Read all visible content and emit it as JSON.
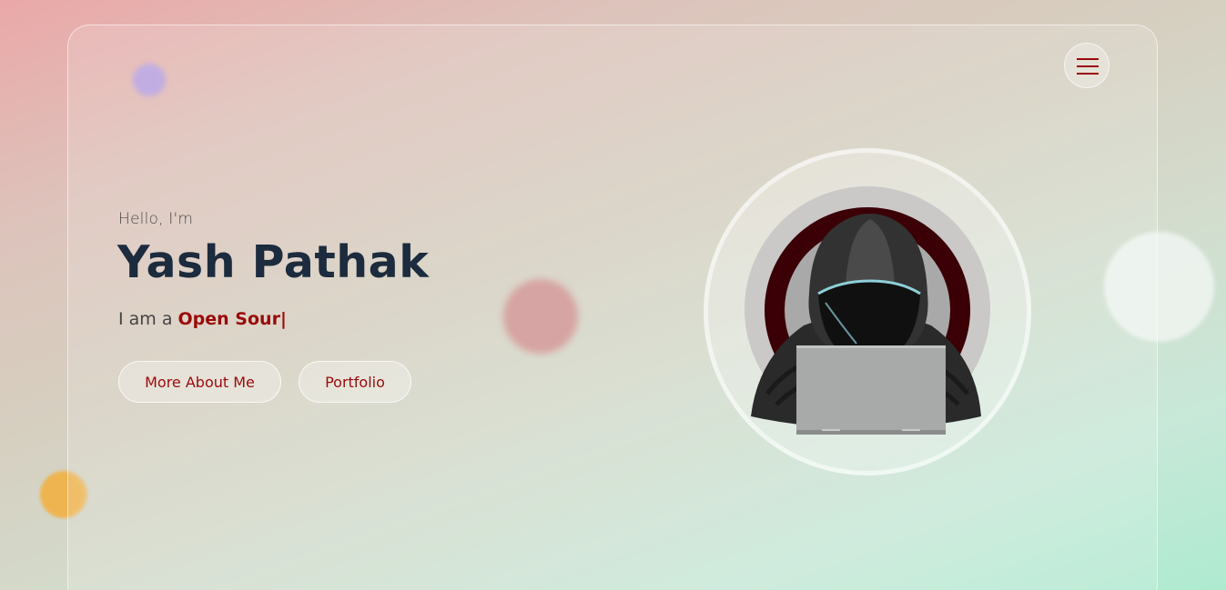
{
  "hero": {
    "greeting": "Hello, I'm",
    "name": "Yash Pathak",
    "role_prefix": "I am a ",
    "role_typed": "Open Sour",
    "caret": "|"
  },
  "buttons": {
    "about_label": "More About Me",
    "portfolio_label": "Portfolio"
  },
  "nav": {
    "menu_icon": "hamburger-menu-icon"
  },
  "avatar": {
    "icon": "hooded-hacker-laptop-illustration"
  },
  "colors": {
    "accent": "#9a0a0a",
    "name_text": "#1c2b3d",
    "blob_purple": "#b7a0de",
    "blob_red": "#d09593",
    "blob_yellow": "#eeb450"
  }
}
